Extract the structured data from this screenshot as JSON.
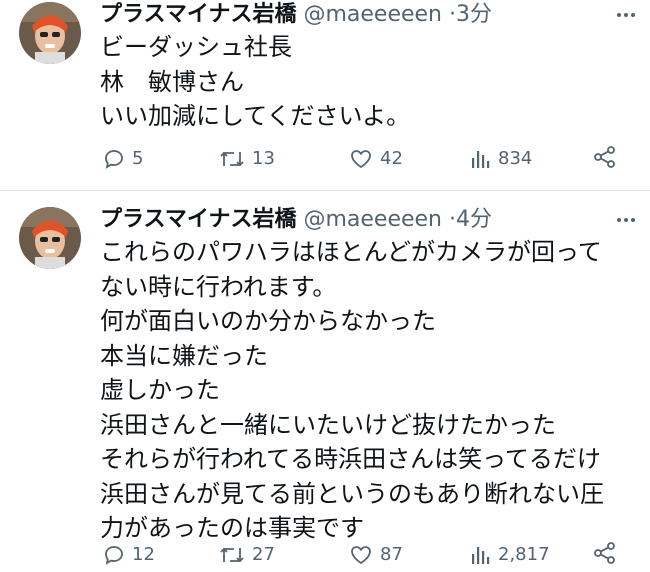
{
  "tweets": [
    {
      "author": "プラスマイナス岩橋",
      "handle": "@maeeeeen",
      "separator": "·",
      "time": "3分",
      "lines": [
        "ビーダッシュ社長",
        "林　敏博さん",
        "いい加減にしてくださいよ。"
      ],
      "replies": "5",
      "retweets": "13",
      "likes": "42",
      "views": "834"
    },
    {
      "author": "プラスマイナス岩橋",
      "handle": "@maeeeeen",
      "separator": "·",
      "time": "4分",
      "lines": [
        "これらのパワハラはほとんどがカメラが回って",
        "ない時に行われます。",
        "何が面白いのか分からなかった",
        "本当に嫌だった",
        "虚しかった",
        "浜田さんと一緒にいたいけど抜けたかった",
        "それらが行われてる時浜田さんは笑ってるだけ",
        "浜田さんが見てる前というのもあり断れない圧",
        "力があったのは事実です"
      ],
      "replies": "12",
      "retweets": "27",
      "likes": "87",
      "views": "2,817"
    }
  ],
  "icons": {
    "reply": "reply-icon",
    "retweet": "retweet-icon",
    "like": "heart-icon",
    "views": "views-chart-icon",
    "share": "share-icon",
    "more": "more-icon"
  },
  "colors": {
    "text": "#0f1419",
    "secondary": "#536471",
    "divider": "#e6e9ec",
    "avatar_accent": "#e0522a"
  }
}
